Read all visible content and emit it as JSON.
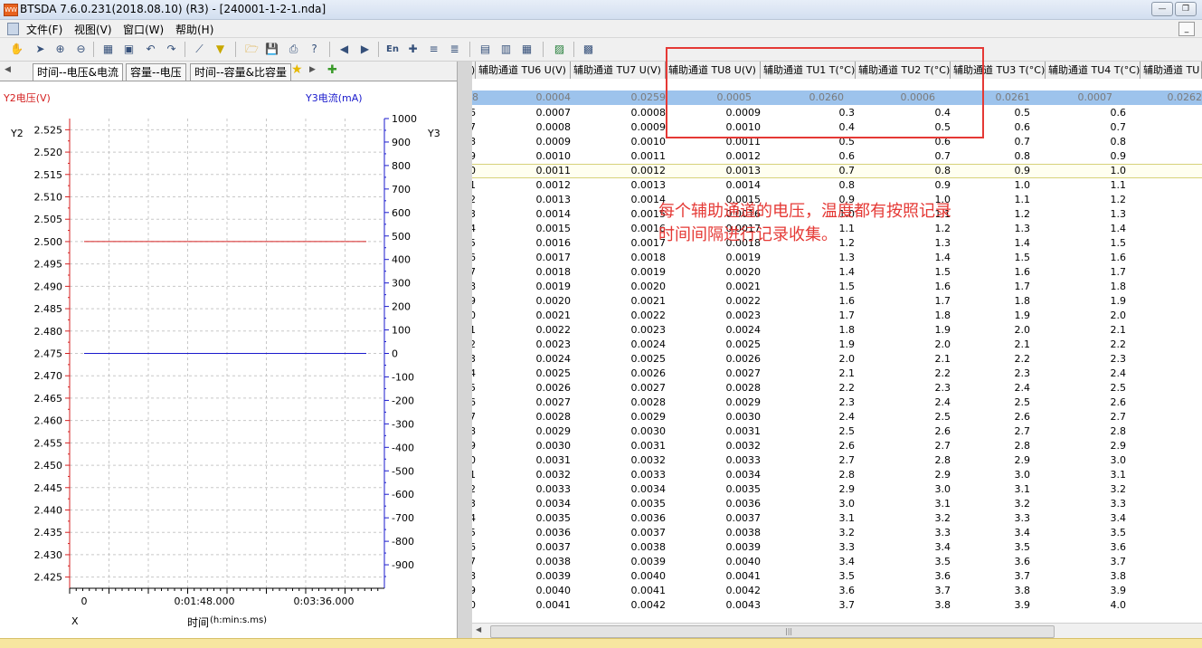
{
  "window": {
    "title": "BTSDA 7.6.0.231(2018.08.10) (R3) - [240001-1-2-1.nda]",
    "icon_text": "WW"
  },
  "menu": {
    "items": [
      "文件(F)",
      "视图(V)",
      "窗口(W)",
      "帮助(H)"
    ]
  },
  "tabs": {
    "items": [
      "时间--电压&电流",
      "容量--电压",
      "时间--容量&比容量"
    ],
    "active": 0
  },
  "chart": {
    "y2_title": "Y2电压(V)",
    "y3_title": "Y3电流(mA)",
    "y2_axis_label": "Y2",
    "y3_axis_label": "Y3",
    "x_axis_label": "X",
    "x_title": "时间",
    "x_unit": "(h:min:s.ms)",
    "colors": {
      "y2": "#d42020",
      "y3": "#1a1acc"
    }
  },
  "chart_data": {
    "type": "line",
    "x_ticks": [
      "0",
      "0:01:48.000",
      "0:03:36.000"
    ],
    "y2_ticks": [
      "2.525",
      "2.520",
      "2.515",
      "2.510",
      "2.505",
      "2.500",
      "2.495",
      "2.490",
      "2.485",
      "2.480",
      "2.475",
      "2.470",
      "2.465",
      "2.460",
      "2.455",
      "2.450",
      "2.445",
      "2.440",
      "2.435",
      "2.430",
      "2.425"
    ],
    "y3_ticks": [
      "1000",
      "900",
      "800",
      "700",
      "600",
      "500",
      "400",
      "300",
      "200",
      "100",
      "0",
      "-100",
      "-200",
      "-300",
      "-400",
      "-500",
      "-600",
      "-700",
      "-800",
      "-900"
    ],
    "y2_range": [
      2.4225,
      2.5275
    ],
    "y3_range": [
      -1000,
      1000
    ],
    "series": [
      {
        "name": "Y2电压(V)",
        "axis": "y2",
        "value": 2.5
      },
      {
        "name": "Y3电流(mA)",
        "axis": "y3",
        "value": 0
      }
    ]
  },
  "grid": {
    "headers": [
      "(V)",
      "辅助通道 TU6 U(V)",
      "辅助通道 TU7 U(V)",
      "辅助通道 TU8 U(V)",
      "辅助通道 TU1 T(°C)",
      "辅助通道 TU2 T(°C)",
      "辅助通道 TU3 T(°C)",
      "辅助通道 TU4 T(°C)",
      "辅助通道 TU"
    ],
    "blue_row": [
      "58",
      "0.0004",
      "0.0259",
      "0.0005",
      "0.0260",
      "0.0006",
      "0.0261",
      "0.0007",
      "0.0262"
    ],
    "rows": [
      [
        "6",
        "0.0007",
        "0.0008",
        "0.0009",
        "0.3",
        "0.4",
        "0.5",
        "0.6"
      ],
      [
        "7",
        "0.0008",
        "0.0009",
        "0.0010",
        "0.4",
        "0.5",
        "0.6",
        "0.7"
      ],
      [
        "8",
        "0.0009",
        "0.0010",
        "0.0011",
        "0.5",
        "0.6",
        "0.7",
        "0.8"
      ],
      [
        "9",
        "0.0010",
        "0.0011",
        "0.0012",
        "0.6",
        "0.7",
        "0.8",
        "0.9"
      ],
      [
        "0",
        "0.0011",
        "0.0012",
        "0.0013",
        "0.7",
        "0.8",
        "0.9",
        "1.0"
      ],
      [
        "1",
        "0.0012",
        "0.0013",
        "0.0014",
        "0.8",
        "0.9",
        "1.0",
        "1.1"
      ],
      [
        "2",
        "0.0013",
        "0.0014",
        "0.0015",
        "0.9",
        "1.0",
        "1.1",
        "1.2"
      ],
      [
        "3",
        "0.0014",
        "0.0015",
        "0.0016",
        "1.0",
        "1.1",
        "1.2",
        "1.3"
      ],
      [
        "4",
        "0.0015",
        "0.0016",
        "0.0017",
        "1.1",
        "1.2",
        "1.3",
        "1.4"
      ],
      [
        "5",
        "0.0016",
        "0.0017",
        "0.0018",
        "1.2",
        "1.3",
        "1.4",
        "1.5"
      ],
      [
        "6",
        "0.0017",
        "0.0018",
        "0.0019",
        "1.3",
        "1.4",
        "1.5",
        "1.6"
      ],
      [
        "7",
        "0.0018",
        "0.0019",
        "0.0020",
        "1.4",
        "1.5",
        "1.6",
        "1.7"
      ],
      [
        "8",
        "0.0019",
        "0.0020",
        "0.0021",
        "1.5",
        "1.6",
        "1.7",
        "1.8"
      ],
      [
        "9",
        "0.0020",
        "0.0021",
        "0.0022",
        "1.6",
        "1.7",
        "1.8",
        "1.9"
      ],
      [
        "0",
        "0.0021",
        "0.0022",
        "0.0023",
        "1.7",
        "1.8",
        "1.9",
        "2.0"
      ],
      [
        "1",
        "0.0022",
        "0.0023",
        "0.0024",
        "1.8",
        "1.9",
        "2.0",
        "2.1"
      ],
      [
        "2",
        "0.0023",
        "0.0024",
        "0.0025",
        "1.9",
        "2.0",
        "2.1",
        "2.2"
      ],
      [
        "3",
        "0.0024",
        "0.0025",
        "0.0026",
        "2.0",
        "2.1",
        "2.2",
        "2.3"
      ],
      [
        "4",
        "0.0025",
        "0.0026",
        "0.0027",
        "2.1",
        "2.2",
        "2.3",
        "2.4"
      ],
      [
        "5",
        "0.0026",
        "0.0027",
        "0.0028",
        "2.2",
        "2.3",
        "2.4",
        "2.5"
      ],
      [
        "6",
        "0.0027",
        "0.0028",
        "0.0029",
        "2.3",
        "2.4",
        "2.5",
        "2.6"
      ],
      [
        "7",
        "0.0028",
        "0.0029",
        "0.0030",
        "2.4",
        "2.5",
        "2.6",
        "2.7"
      ],
      [
        "8",
        "0.0029",
        "0.0030",
        "0.0031",
        "2.5",
        "2.6",
        "2.7",
        "2.8"
      ],
      [
        "9",
        "0.0030",
        "0.0031",
        "0.0032",
        "2.6",
        "2.7",
        "2.8",
        "2.9"
      ],
      [
        "0",
        "0.0031",
        "0.0032",
        "0.0033",
        "2.7",
        "2.8",
        "2.9",
        "3.0"
      ],
      [
        "1",
        "0.0032",
        "0.0033",
        "0.0034",
        "2.8",
        "2.9",
        "3.0",
        "3.1"
      ],
      [
        "2",
        "0.0033",
        "0.0034",
        "0.0035",
        "2.9",
        "3.0",
        "3.1",
        "3.2"
      ],
      [
        "3",
        "0.0034",
        "0.0035",
        "0.0036",
        "3.0",
        "3.1",
        "3.2",
        "3.3"
      ],
      [
        "4",
        "0.0035",
        "0.0036",
        "0.0037",
        "3.1",
        "3.2",
        "3.3",
        "3.4"
      ],
      [
        "5",
        "0.0036",
        "0.0037",
        "0.0038",
        "3.2",
        "3.3",
        "3.4",
        "3.5"
      ],
      [
        "6",
        "0.0037",
        "0.0038",
        "0.0039",
        "3.3",
        "3.4",
        "3.5",
        "3.6"
      ],
      [
        "7",
        "0.0038",
        "0.0039",
        "0.0040",
        "3.4",
        "3.5",
        "3.6",
        "3.7"
      ],
      [
        "8",
        "0.0039",
        "0.0040",
        "0.0041",
        "3.5",
        "3.6",
        "3.7",
        "3.8"
      ],
      [
        "9",
        "0.0040",
        "0.0041",
        "0.0042",
        "3.6",
        "3.7",
        "3.8",
        "3.9"
      ],
      [
        "0",
        "0.0041",
        "0.0042",
        "0.0043",
        "3.7",
        "3.8",
        "3.9",
        "4.0"
      ]
    ],
    "highlighted_row": 4
  },
  "annotation": {
    "line1": "每个辅助通道的电压，温度都有按照记录",
    "line2": "时间间隔进行记录收集。",
    "color": "#e53935"
  },
  "toolbar": {
    "en_label": "En"
  }
}
